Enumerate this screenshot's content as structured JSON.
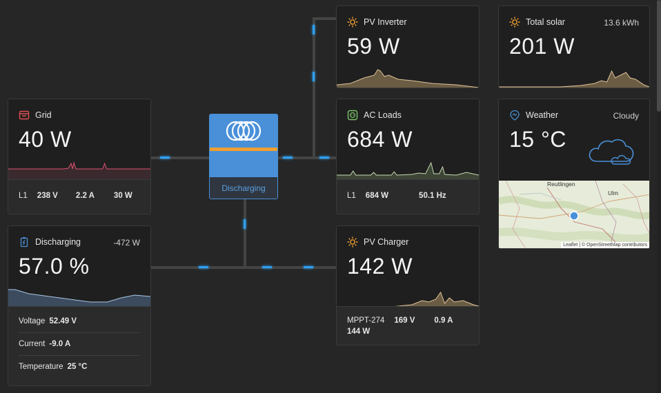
{
  "grid": {
    "title": "Grid",
    "power": "40 W",
    "l1": "L1",
    "voltage": "238 V",
    "current": "2.2 A",
    "watts": "30 W",
    "accent": "#e05050"
  },
  "inverter": {
    "status": "Discharging"
  },
  "pv_inverter": {
    "title": "PV Inverter",
    "power": "59 W"
  },
  "total_solar": {
    "title": "Total solar",
    "energy": "13.6 kWh",
    "power": "201 W"
  },
  "ac_loads": {
    "title": "AC Loads",
    "power": "684 W",
    "l1": "L1",
    "watts": "684 W",
    "frequency": "50.1 Hz",
    "accent": "#7ac36a"
  },
  "weather": {
    "title": "Weather",
    "condition": "Cloudy",
    "temperature": "15 °C",
    "map_city1": "Reutlingen",
    "map_city2": "Ulm",
    "map_attribution": "Leaflet | © OpenStreetMap contributors"
  },
  "battery": {
    "title": "Discharging",
    "power": "-472 W",
    "soc": "57.0 %",
    "accent": "#4a90d9",
    "rows": [
      {
        "label": "Voltage",
        "value": "52.49 V"
      },
      {
        "label": "Current",
        "value": "-9.0 A"
      },
      {
        "label": "Temperature",
        "value": "25 °C"
      }
    ]
  },
  "pv_charger": {
    "title": "PV Charger",
    "power": "142 W",
    "name": "MPPT-274",
    "voltage": "169 V",
    "current": "0.9 A",
    "watts": "144 W"
  },
  "colors": {
    "solar": "#f0a030",
    "background": "#262626",
    "card": "#1f1f1f"
  }
}
